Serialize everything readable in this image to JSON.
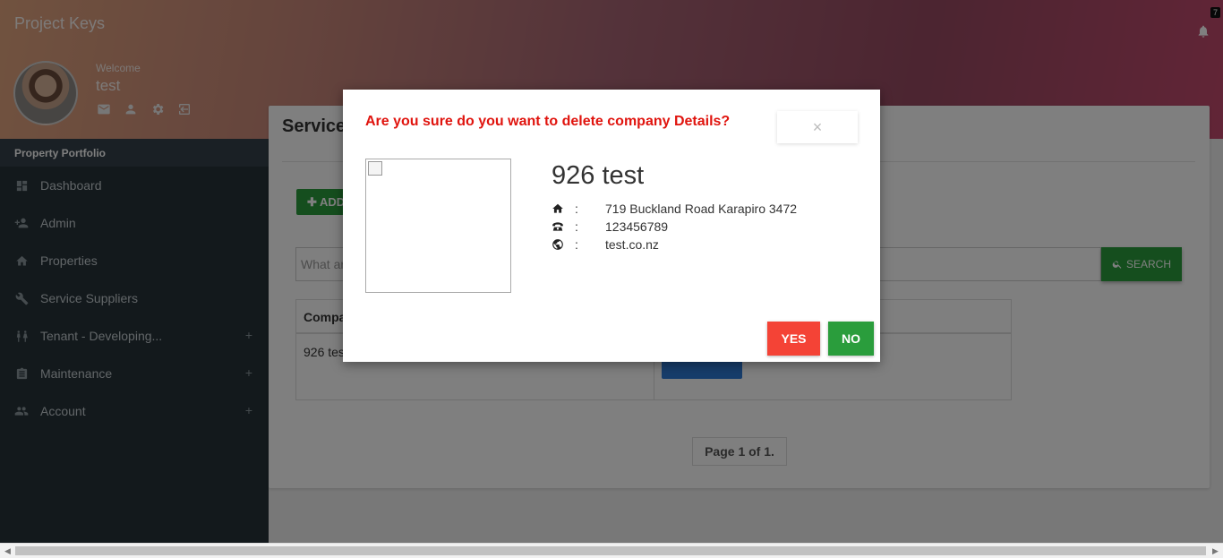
{
  "app": {
    "brand": "Project Keys",
    "notification_count": "7"
  },
  "user": {
    "welcome": "Welcome",
    "name": "test"
  },
  "sidebar": {
    "section": "Property Portfolio",
    "items": [
      {
        "label": "Dashboard",
        "icon": "dashboard-icon",
        "expandable": false
      },
      {
        "label": "Admin",
        "icon": "person-add-icon",
        "expandable": false
      },
      {
        "label": "Properties",
        "icon": "home-icon",
        "expandable": false
      },
      {
        "label": "Service Suppliers",
        "icon": "wrench-icon",
        "expandable": false
      },
      {
        "label": "Tenant - Developing...",
        "icon": "people-icon",
        "expandable": true
      },
      {
        "label": "Maintenance",
        "icon": "clipboard-icon",
        "expandable": true
      },
      {
        "label": "Account",
        "icon": "group-icon",
        "expandable": true
      }
    ],
    "expand_symbol": "+"
  },
  "main": {
    "title": "Service",
    "add_button": "ADD",
    "search_placeholder": "What ar",
    "search_button": "SEARCH",
    "table_header": "Compa",
    "row_company": "926 tes",
    "pager": "Page 1 of 1."
  },
  "modal": {
    "title": "Are you sure do you want to delete company Details?",
    "close": "×",
    "company_name": "926 test",
    "address": "719 Buckland Road Karapiro 3472",
    "phone": "123456789",
    "website": "test.co.nz",
    "separator": ":",
    "yes": "YES",
    "no": "NO"
  },
  "colors": {
    "danger": "#f44336",
    "title_red": "#e0140e",
    "success": "#2a9d3c",
    "sidebar": "#263238"
  }
}
